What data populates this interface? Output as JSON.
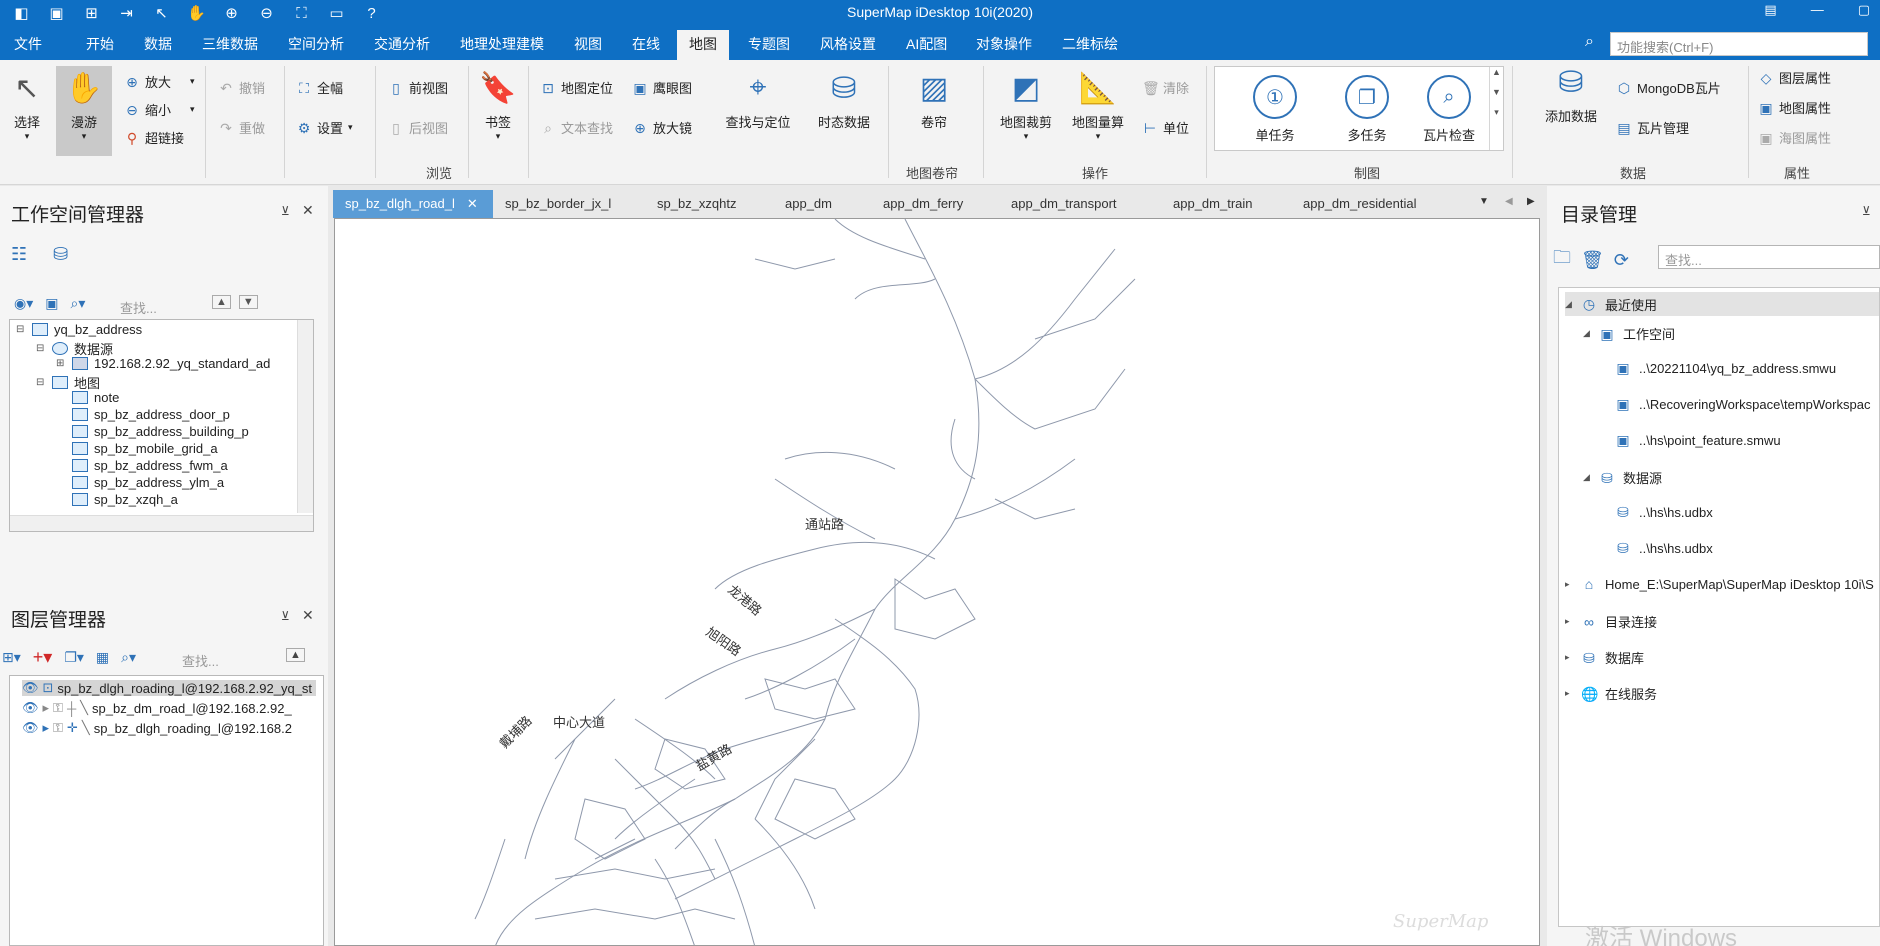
{
  "app": {
    "title": "SuperMap iDesktop 10i(2020)",
    "quick_access": [
      "app-logo-icon",
      "save-icon",
      "new-icon",
      "open-icon",
      "pointer-icon",
      "pan-icon",
      "zoom-in-icon",
      "zoom-out-icon",
      "full-extent-icon",
      "folder-icon",
      "help-icon"
    ],
    "window_buttons": [
      "restore-icon",
      "minimize-icon",
      "maximize-icon"
    ]
  },
  "menu": {
    "tabs": [
      "文件",
      "开始",
      "数据",
      "三维数据",
      "空间分析",
      "交通分析",
      "地理处理建模",
      "视图",
      "在线",
      "地图",
      "专题图",
      "风格设置",
      "AI配图",
      "对象操作",
      "二维标绘"
    ],
    "active_tab": "地图",
    "search_placeholder": "功能搜索(Ctrl+F)"
  },
  "ribbon": {
    "select": "选择",
    "pan": "漫游",
    "zoom_in": "放大",
    "zoom_out": "缩小",
    "hyperlink": "超链接",
    "undo": "撤销",
    "redo": "重做",
    "full_extent": "全幅",
    "settings": "设置",
    "prev_view": "前视图",
    "next_view": "后视图",
    "bookmark": "书签",
    "locate_map": "地图定位",
    "text_find": "文本查找",
    "eagle_eye": "鹰眼图",
    "magnifier": "放大镜",
    "find_locate": "查找与定位",
    "temporal_data": "时态数据",
    "curtain": "卷帘",
    "map_clip": "地图裁剪",
    "map_measure": "地图量算",
    "clear": "清除",
    "unit": "单位",
    "single_task": "单任务",
    "multi_task": "多任务",
    "tile_check": "瓦片检查",
    "add_data": "添加数据",
    "mongodb_tile": "MongoDB瓦片",
    "tile_manage": "瓦片管理",
    "layer_props": "图层属性",
    "map_props": "地图属性",
    "chart_props": "海图属性",
    "groups": {
      "browse": "浏览",
      "curtain": "地图卷帘",
      "operate": "操作",
      "cartography": "制图",
      "data": "数据",
      "props": "属性"
    }
  },
  "workspace": {
    "title": "工作空间管理器",
    "search_placeholder": "查找...",
    "tree": {
      "root": "yq_bz_address",
      "datasource_group": "数据源",
      "datasource": "192.168.2.92_yq_standard_ad",
      "map_group": "地图",
      "maps": [
        "note",
        "sp_bz_address_door_p",
        "sp_bz_address_building_p",
        "sp_bz_mobile_grid_a",
        "sp_bz_address_fwm_a",
        "sp_bz_address_ylm_a",
        "sp_bz_xzqh_a"
      ]
    }
  },
  "layers": {
    "title": "图层管理器",
    "search_placeholder": "查找...",
    "items": [
      "sp_bz_dlgh_roading_l@192.168.2.92_yq_st",
      "sp_bz_dm_road_l@192.168.2.92_",
      "sp_bz_dlgh_roading_l@192.168.2"
    ]
  },
  "doc_tabs": [
    "sp_bz_dlgh_road_l",
    "sp_bz_border_jx_l",
    "sp_bz_xzqhtz",
    "app_dm",
    "app_dm_ferry",
    "app_dm_transport",
    "app_dm_train",
    "app_dm_residential"
  ],
  "map_labels": [
    "通站路",
    "龙港路",
    "旭阳路",
    "中心大道",
    "戴埔路",
    "盐黄路"
  ],
  "watermark": "SuperMap",
  "catalog": {
    "title": "目录管理",
    "search_placeholder": "查找...",
    "recent": "最近使用",
    "workspace_group": "工作空间",
    "workspaces": [
      "..\\20221104\\yq_bz_address.smwu",
      "..\\RecoveringWorkspace\\tempWorkspac",
      "..\\hs\\point_feature.smwu"
    ],
    "datasource_group": "数据源",
    "datasources": [
      "..\\hs\\hs.udbx",
      "..\\hs\\hs.udbx"
    ],
    "home": "Home_E:\\SuperMap\\SuperMap iDesktop 10i\\S",
    "dir_connect": "目录连接",
    "database": "数据库",
    "online": "在线服务"
  },
  "activate_text": "激活 Windows"
}
